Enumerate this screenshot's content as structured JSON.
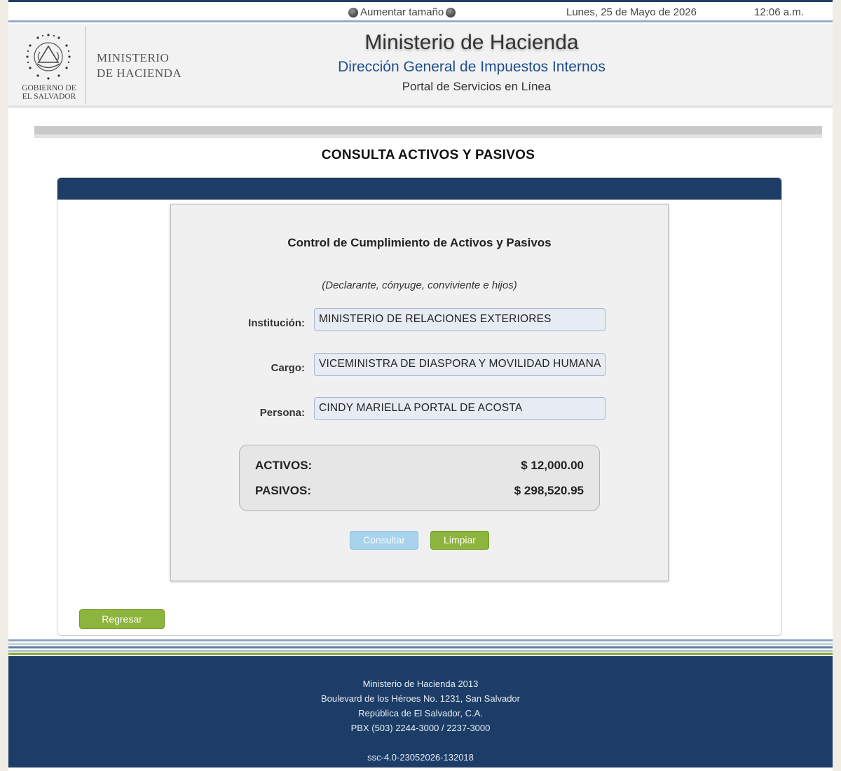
{
  "topbar": {
    "enlarge_label": "Aumentar tamaño",
    "date": "Lunes, 25 de Mayo de 2026",
    "time": "12:06 a.m."
  },
  "header": {
    "logo_line1": "MINISTERIO",
    "logo_line2": "DE HACIENDA",
    "gov_line1": "GOBIERNO DE",
    "gov_line2": "EL SALVADOR",
    "title": "Ministerio de Hacienda",
    "subtitle": "Dirección General de Impuestos Internos",
    "portal": "Portal de Servicios en Línea"
  },
  "page_title": "CONSULTA ACTIVOS Y PASIVOS",
  "form": {
    "title": "Control de Cumplimiento de Activos y Pasivos",
    "note": "(Declarante, cónyuge, conviviente e hijos)",
    "institucion_label": "Institución:",
    "institucion_value": "MINISTERIO DE RELACIONES EXTERIORES",
    "cargo_label": "Cargo:",
    "cargo_value": "VICEMINISTRA DE DIASPORA Y MOVILIDAD HUMANA",
    "persona_label": "Persona:",
    "persona_value": "CINDY MARIELLA PORTAL DE ACOSTA",
    "activos_label": "ACTIVOS:",
    "activos_value": "$ 12,000.00",
    "pasivos_label": "PASIVOS:",
    "pasivos_value": "$ 298,520.95",
    "consultar_label": "Consultar",
    "limpiar_label": "Limpiar"
  },
  "regresar_label": "Regresar",
  "footer": {
    "line1": "Ministerio de Hacienda 2013",
    "line2": "Boulevard de los Héroes No. 1231, San Salvador",
    "line3": "República de El Salvador, C.A.",
    "line4": "PBX (503) 2244-3000 / 2237-3000",
    "version": "ssc-4.0-23052026-132018"
  },
  "colors": {
    "navy": "#1d3d66",
    "green_button": "#8db43c",
    "disabled_blue_button": "#a8d3ec",
    "subtitle_blue": "#1f4e8c"
  },
  "icons": [
    "globe-icon",
    "seal-icon"
  ]
}
